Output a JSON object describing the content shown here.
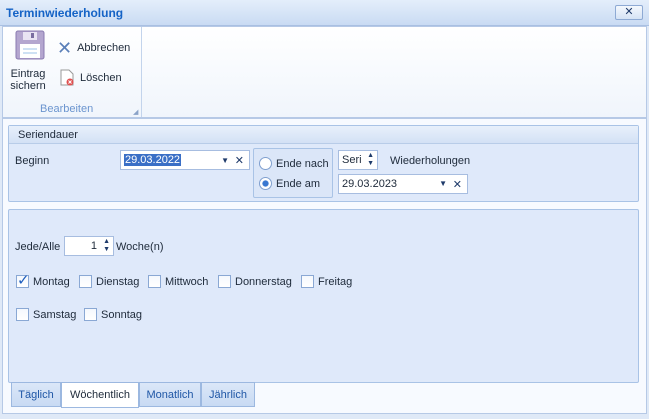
{
  "window": {
    "title": "Terminwiederholung",
    "close_label": "x"
  },
  "ribbon": {
    "save_label_1": "Eintrag",
    "save_label_2": "sichern",
    "cancel_label": "Abbrechen",
    "delete_label": "Löschen",
    "group_label": "Bearbeiten"
  },
  "duration": {
    "header": "Seriendauer",
    "begin_label": "Beginn",
    "begin_value": "29.03.2022",
    "end_after_label": "Ende nach",
    "end_on_label": "Ende am",
    "end_mode": "Ende am",
    "repeat_value": "Seri",
    "repeat_label": "Wiederholungen",
    "end_value": "29.03.2023"
  },
  "weekly": {
    "every_label": "Jede/Alle",
    "every_value": "1",
    "unit_label": "Woche(n)",
    "days": [
      {
        "label": "Montag",
        "checked": true
      },
      {
        "label": "Dienstag",
        "checked": false
      },
      {
        "label": "Mittwoch",
        "checked": false
      },
      {
        "label": "Donnerstag",
        "checked": false
      },
      {
        "label": "Freitag",
        "checked": false
      },
      {
        "label": "Samstag",
        "checked": false
      },
      {
        "label": "Sonntag",
        "checked": false
      }
    ]
  },
  "tabs": [
    {
      "label": "Täglich"
    },
    {
      "label": "Wöchentlich",
      "active": true
    },
    {
      "label": "Monatlich"
    },
    {
      "label": "Jährlich"
    }
  ]
}
